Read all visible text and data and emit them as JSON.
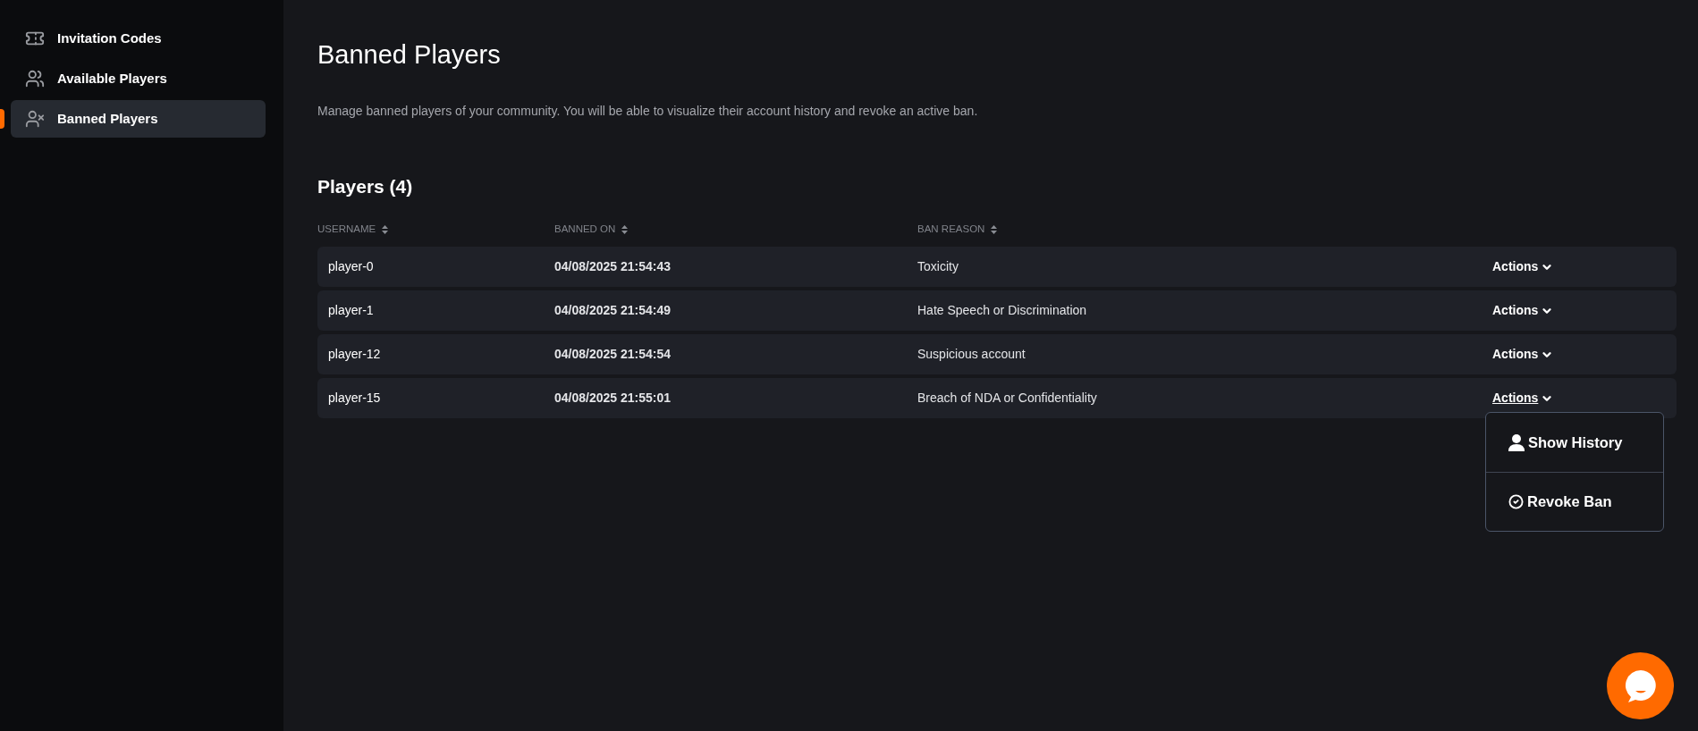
{
  "sidebar": {
    "items": [
      {
        "label": "Invitation Codes",
        "selected": false
      },
      {
        "label": "Available Players",
        "selected": false
      },
      {
        "label": "Banned Players",
        "selected": true
      }
    ]
  },
  "page": {
    "title": "Banned Players",
    "description": "Manage banned players of your community. You will be able to visualize their account history and revoke an active ban."
  },
  "table": {
    "title": "Players (4)",
    "columns": [
      "USERNAME",
      "BANNED ON",
      "BAN REASON"
    ],
    "rows": [
      {
        "username": "player-0",
        "banned_on": "04/08/2025 21:54:43",
        "reason": "Toxicity",
        "actions": "Actions",
        "expanded": false
      },
      {
        "username": "player-1",
        "banned_on": "04/08/2025 21:54:49",
        "reason": "Hate Speech or Discrimination",
        "actions": "Actions",
        "expanded": false
      },
      {
        "username": "player-12",
        "banned_on": "04/08/2025 21:54:54",
        "reason": "Suspicious account",
        "actions": "Actions",
        "expanded": false
      },
      {
        "username": "player-15",
        "banned_on": "04/08/2025 21:55:01",
        "reason": "Breach of NDA or Confidentiality",
        "actions": "Actions",
        "expanded": true
      }
    ]
  },
  "actions_menu": [
    {
      "label": "Show History"
    },
    {
      "label": "Revoke Ban"
    }
  ]
}
